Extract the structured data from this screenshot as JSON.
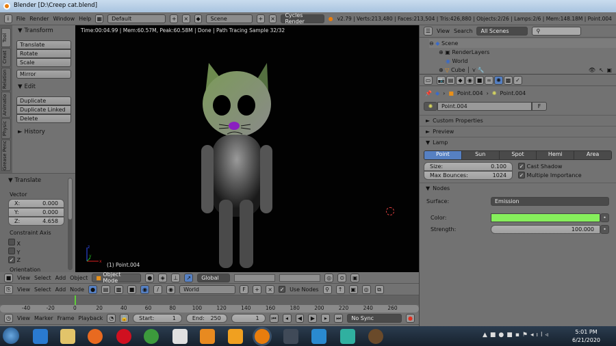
{
  "window": {
    "title": "Blender [D:\\Creep cat.blend]"
  },
  "info_header": {
    "menus": [
      "File",
      "Render",
      "Window",
      "Help"
    ],
    "screen_layout": "Default",
    "scene": "Scene",
    "render_engine": "Cycles Render",
    "stats": "v2.79 | Verts:213,480 | Faces:213,504 | Tris:426,880 | Objects:2/26 | Lamps:2/6 | Mem:148.18M | Point.004"
  },
  "toolshelf": {
    "tabs": [
      "Tool",
      "Creat",
      "Relation",
      "Animatio",
      "Physic",
      "Grease Penc"
    ],
    "transform": {
      "title": "Transform",
      "buttons": [
        "Translate",
        "Rotate",
        "Scale"
      ],
      "mirror": "Mirror"
    },
    "edit": {
      "title": "Edit",
      "buttons": [
        "Duplicate",
        "Duplicate Linked",
        "Delete"
      ]
    },
    "history": {
      "title": "History"
    }
  },
  "operator": {
    "title": "Translate",
    "vector_label": "Vector",
    "x_label": "X:",
    "x": "0.000",
    "y_label": "Y:",
    "y": "0.000",
    "z_label": "Z:",
    "z": "4.658",
    "constraint_label": "Constraint Axis",
    "axes": [
      {
        "label": "X",
        "checked": false
      },
      {
        "label": "Y",
        "checked": false
      },
      {
        "label": "Z",
        "checked": true
      }
    ],
    "orientation_label": "Orientation"
  },
  "viewport": {
    "render_status": "Time:00:04.99 | Mem:60.57M, Peak:60.58M | Done | Path Tracing Sample 32/32",
    "object_label": "(1) Point.004",
    "axis_x": "x",
    "axis_y": "y",
    "axis_z": "z"
  },
  "view3d_header": {
    "menus": [
      "View",
      "Select",
      "Add",
      "Object"
    ],
    "mode": "Object Mode",
    "orientation": "Global"
  },
  "node_header": {
    "menus": [
      "View",
      "Select",
      "Add",
      "Node"
    ],
    "world": "World",
    "f": "F",
    "use_nodes": "Use Nodes",
    "use_nodes_checked": true
  },
  "timeline": {
    "ticks": [
      "-40",
      "-20",
      "0",
      "20",
      "40",
      "60",
      "80",
      "100",
      "120",
      "140",
      "160",
      "180",
      "200",
      "220",
      "240",
      "260"
    ],
    "menus": [
      "View",
      "Marker",
      "Frame",
      "Playback"
    ],
    "start_label": "Start:",
    "start": "1",
    "end_label": "End:",
    "end": "250",
    "current": "1",
    "sync": "No Sync"
  },
  "outliner": {
    "menus": [
      "View",
      "Search"
    ],
    "filter": "All Scenes",
    "items": [
      "Scene",
      "RenderLayers",
      "World",
      "Cube"
    ]
  },
  "properties": {
    "breadcrumb": [
      "Point.004",
      "Point.004"
    ],
    "datablock": "Point.004",
    "fake_user": "F",
    "panels": {
      "custom_props": "Custom Properties",
      "preview": "Preview",
      "lamp": "Lamp",
      "nodes": "Nodes"
    },
    "lamp_types": [
      "Point",
      "Sun",
      "Spot",
      "Hemi",
      "Area"
    ],
    "lamp_type_active": "Point",
    "size_label": "Size:",
    "size": "0.100",
    "bounces_label": "Max Bounces:",
    "bounces": "1024",
    "cast_shadow": "Cast Shadow",
    "multiple_importance": "Multiple Importance",
    "surface_label": "Surface:",
    "surface": "Emission",
    "color_label": "Color:",
    "color": "#86ef5c",
    "strength_label": "Strength:",
    "strength": "100.000"
  },
  "taskbar": {
    "time": "5:01 PM",
    "date": "6/21/2020"
  },
  "colors": {
    "accent": "#5680c2",
    "emission": "#86ef5c"
  }
}
